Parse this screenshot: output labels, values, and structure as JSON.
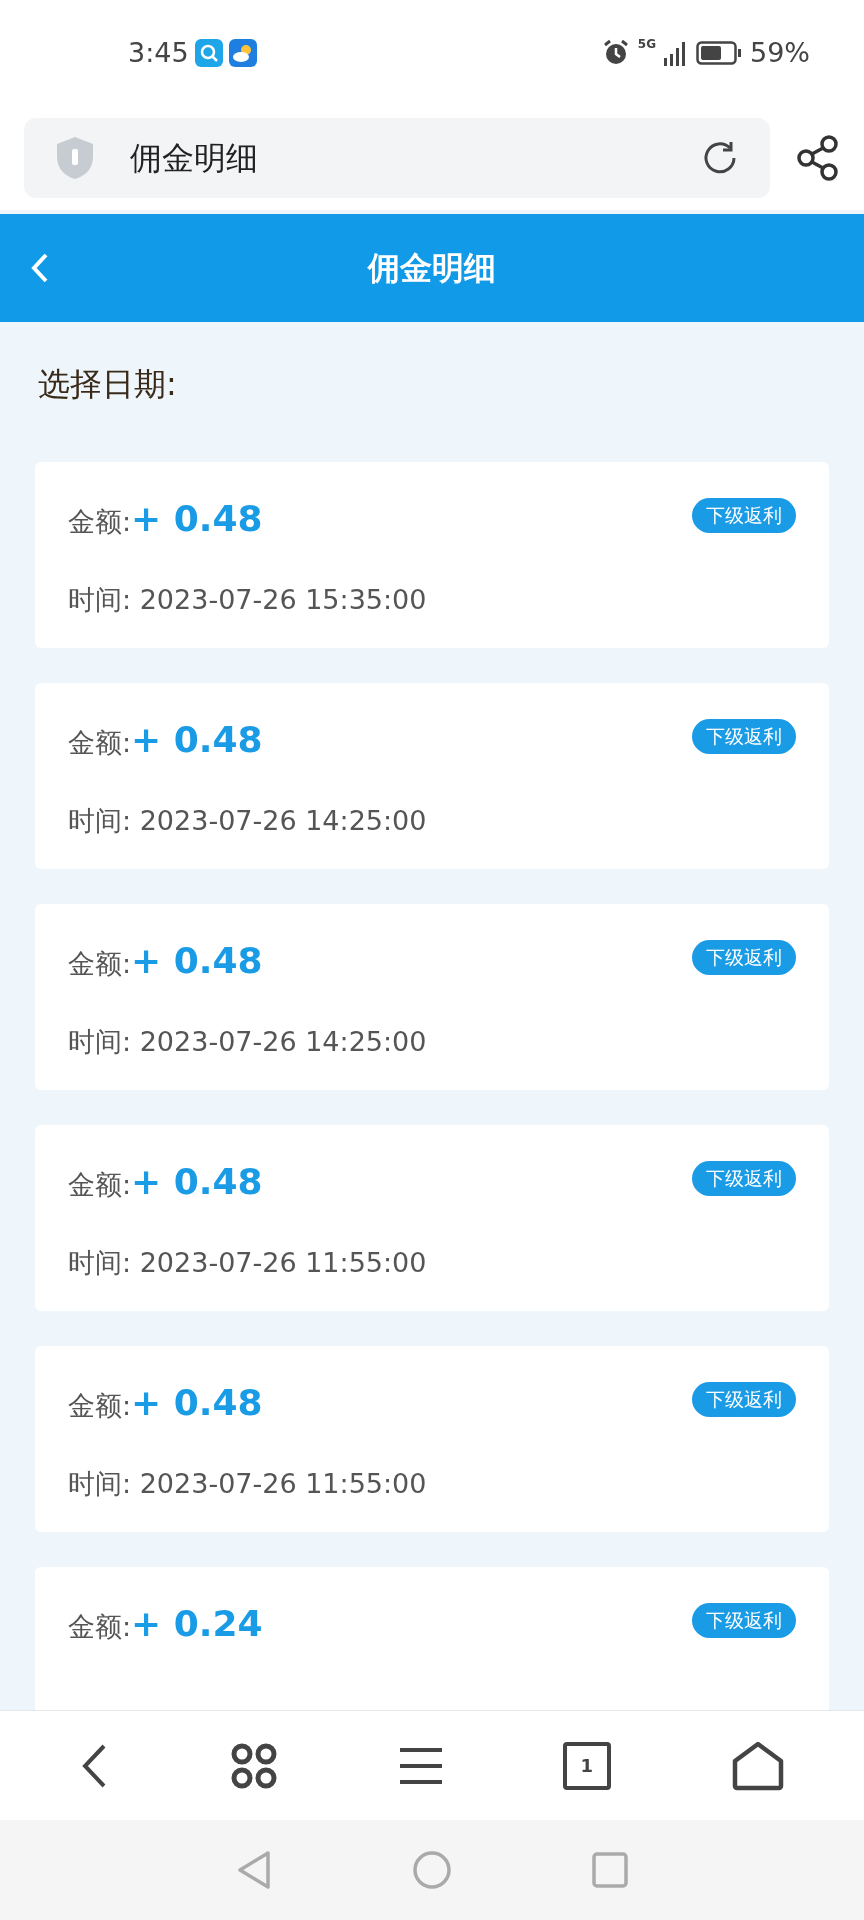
{
  "status_bar": {
    "time": "3:45",
    "network": "5G",
    "battery": "59%"
  },
  "address_bar": {
    "title": "佣金明细"
  },
  "header": {
    "title": "佣金明细"
  },
  "date_filter": {
    "label": "选择日期:"
  },
  "records": [
    {
      "amount_label": "金额:",
      "amount": "+ 0.48",
      "badge": "下级返利",
      "time": "时间: 2023-07-26 15:35:00"
    },
    {
      "amount_label": "金额:",
      "amount": "+ 0.48",
      "badge": "下级返利",
      "time": "时间: 2023-07-26 14:25:00"
    },
    {
      "amount_label": "金额:",
      "amount": "+ 0.48",
      "badge": "下级返利",
      "time": "时间: 2023-07-26 14:25:00"
    },
    {
      "amount_label": "金额:",
      "amount": "+ 0.48",
      "badge": "下级返利",
      "time": "时间: 2023-07-26 11:55:00"
    },
    {
      "amount_label": "金额:",
      "amount": "+ 0.48",
      "badge": "下级返利",
      "time": "时间: 2023-07-26 11:55:00"
    },
    {
      "amount_label": "金额:",
      "amount": "+ 0.24",
      "badge": "下级返利"
    }
  ],
  "tab_count": "1"
}
